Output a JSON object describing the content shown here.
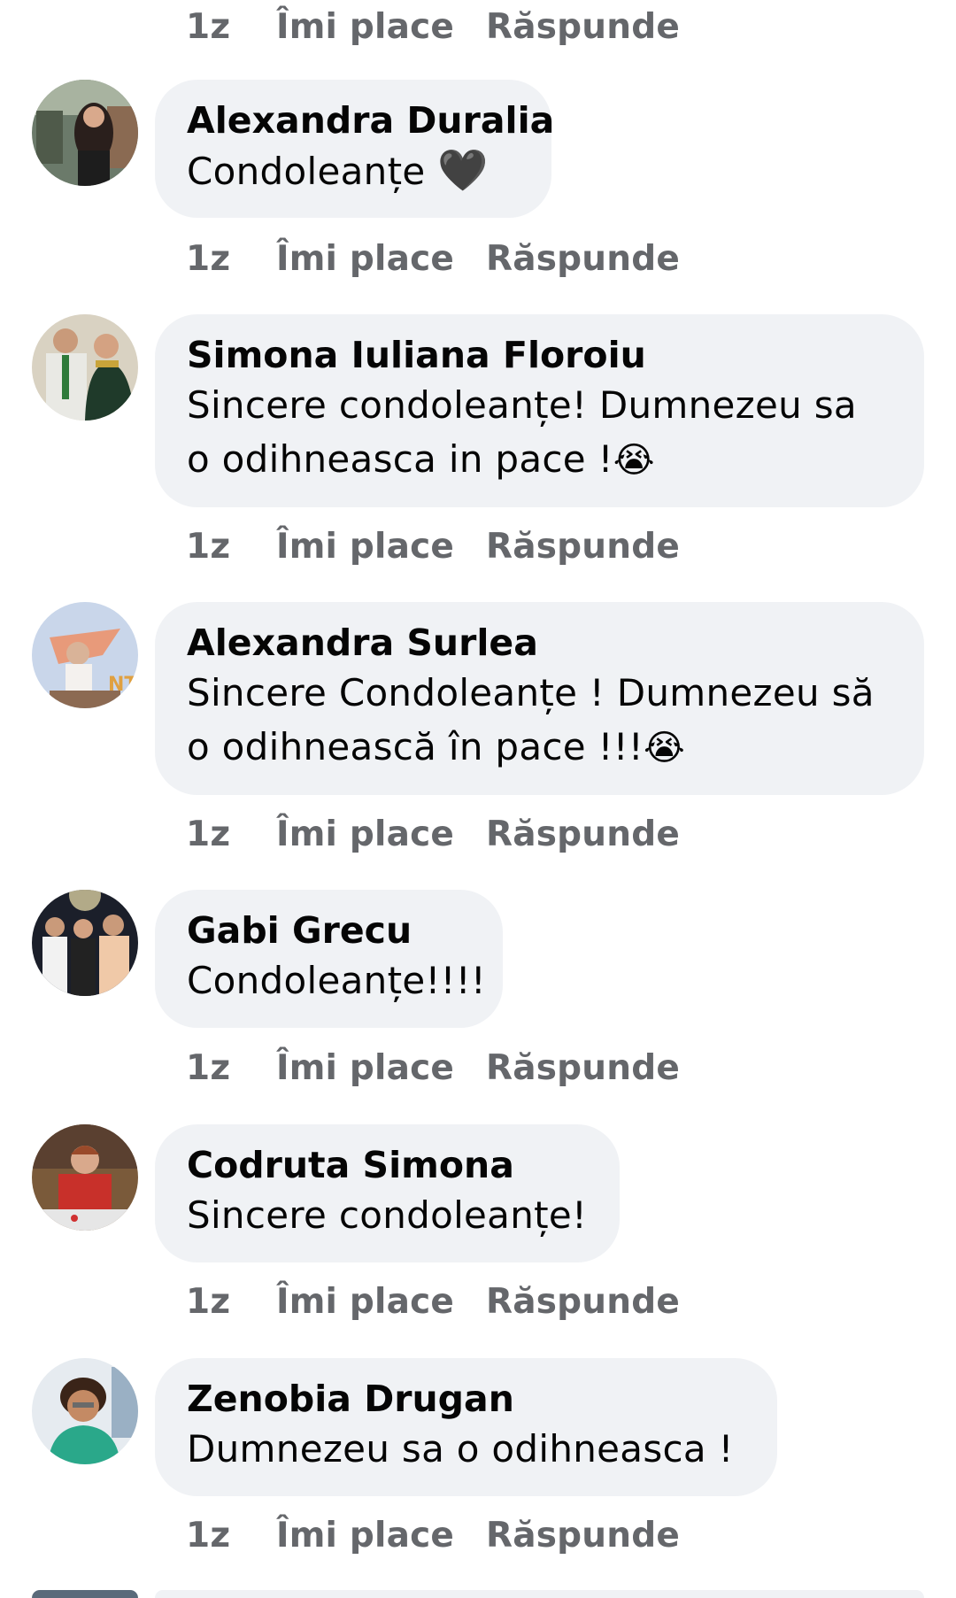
{
  "comments": [
    {
      "author": "Alexandra Duralia",
      "lines": [
        "Condoleanțe ",
        ""
      ],
      "emoji": "🖤",
      "time": "1z",
      "like": "Îmi place",
      "reply": "Răspunde"
    },
    {
      "author": "Simona Iuliana Floroiu",
      "lines": [
        "Sincere condoleanțe! Dumnezeu sa",
        "o odihneasca in pace !"
      ],
      "emoji": "😭",
      "time": "1z",
      "like": "Îmi place",
      "reply": "Răspunde"
    },
    {
      "author": "Alexandra Surlea",
      "lines": [
        "Sincere Condoleanțe ! Dumnezeu să",
        "o odihnească în pace !!!"
      ],
      "emoji": "😭",
      "time": "1z",
      "like": "Îmi place",
      "reply": "Răspunde"
    },
    {
      "author": "Gabi Grecu",
      "lines": [
        "Condoleanțe!!!!"
      ],
      "time": "1z",
      "like": "Îmi place",
      "reply": "Răspunde"
    },
    {
      "author": "Codruta Simona",
      "lines": [
        "Sincere condoleanțe!"
      ],
      "time": "1z",
      "like": "Îmi place",
      "reply": "Răspunde"
    },
    {
      "author": "Zenobia Drugan",
      "lines": [
        "Dumnezeu sa o odihneasca  !"
      ],
      "time": "1z",
      "like": "Îmi place",
      "reply": "Răspunde"
    }
  ],
  "top_actions": {
    "time": "1z",
    "like": "Îmi place",
    "reply": "Răspunde"
  },
  "colors": {
    "bubble": "#f0f2f5",
    "meta": "#65676b",
    "text": "#050505"
  }
}
